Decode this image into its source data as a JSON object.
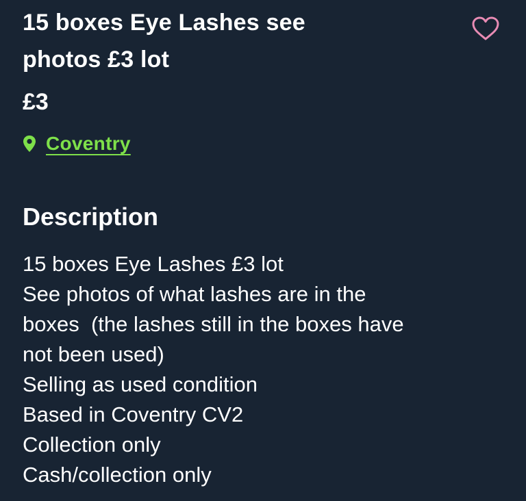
{
  "listing": {
    "title_line1": "15 boxes Eye Lashes see",
    "title_line2": "photos £3 lot",
    "price": "£3",
    "location": "Coventry"
  },
  "favorite": {
    "icon": "heart-outline-icon",
    "color": "#e88bb4"
  },
  "location_icon": {
    "icon": "map-pin-icon",
    "color": "#7ee04a"
  },
  "description": {
    "heading": "Description",
    "lines": [
      "15 boxes Eye Lashes £3 lot",
      "See photos of what lashes are in the",
      "boxes  (the lashes still in the boxes have",
      "not been used)",
      "Selling as used condition",
      "Based in Coventry CV2",
      "Collection only",
      "Cash/collection only"
    ]
  },
  "colors": {
    "background": "#182433",
    "text": "#ffffff",
    "accent_green": "#7ee04a",
    "heart_pink": "#e88bb4"
  }
}
